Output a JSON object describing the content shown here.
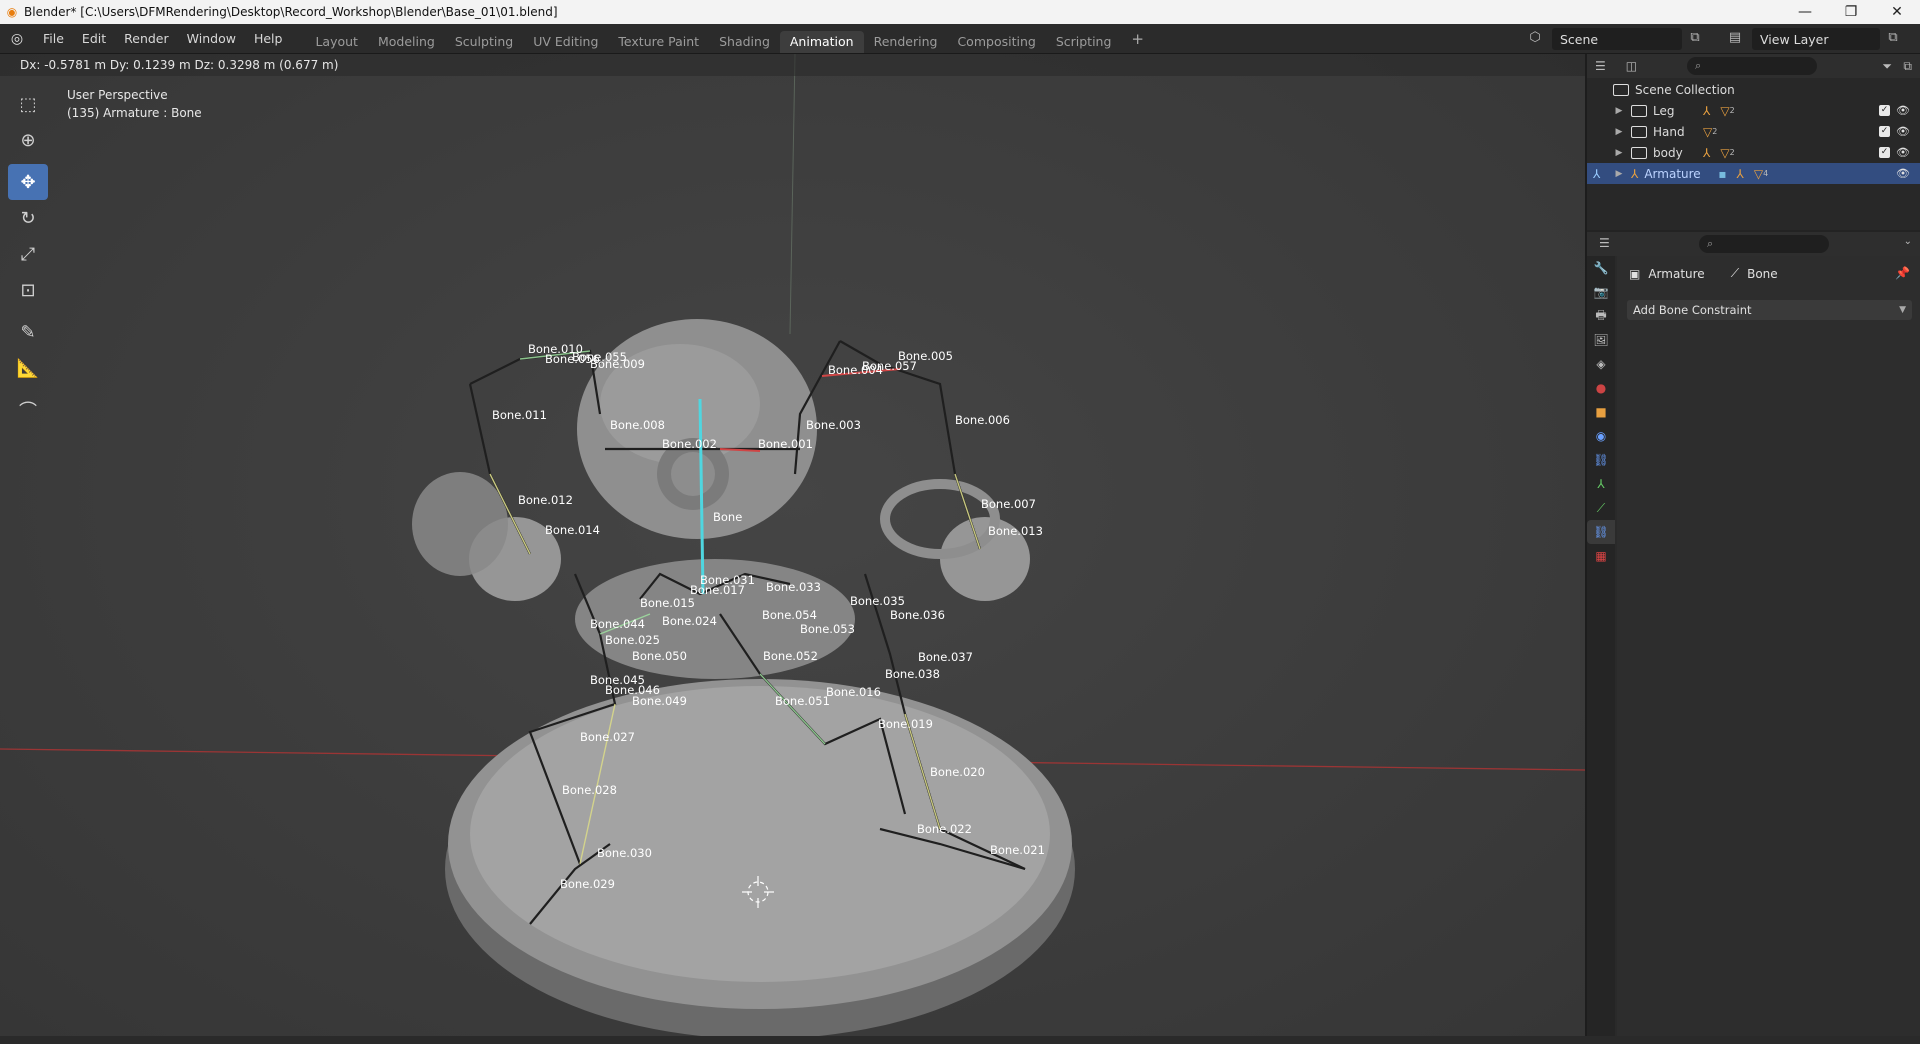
{
  "window": {
    "title": "Blender* [C:\\Users\\DFMRendering\\Desktop\\Record_Workshop\\Blender\\Base_01\\01.blend]",
    "minimize": "—",
    "maximize": "❐",
    "close": "✕"
  },
  "menu": [
    "File",
    "Edit",
    "Render",
    "Window",
    "Help"
  ],
  "workspaces": [
    "Layout",
    "Modeling",
    "Sculpting",
    "UV Editing",
    "Texture Paint",
    "Shading",
    "Animation",
    "Rendering",
    "Compositing",
    "Scripting"
  ],
  "active_workspace": "Animation",
  "add_workspace": "+",
  "scene_name": "Scene",
  "view_layer": "View Layer",
  "viewport": {
    "header_text": "Dx: -0.5781 m  Dy: 0.1239 m  Dz: 0.3298 m (0.677 m)",
    "view_name": "User Perspective",
    "selection_info": "(135) Armature : Bone",
    "bones": [
      {
        "label": "Bone.010"
      },
      {
        "label": "Bone.056"
      },
      {
        "label": "Bone.009"
      },
      {
        "label": "Bone.055"
      },
      {
        "label": "Bone.011"
      },
      {
        "label": "Bone.008"
      },
      {
        "label": "Bone.002"
      },
      {
        "label": "Bone.001"
      },
      {
        "label": "Bone.003"
      },
      {
        "label": "Bone.005"
      },
      {
        "label": "Bone.004"
      },
      {
        "label": "Bone.057"
      },
      {
        "label": "Bone.006"
      },
      {
        "label": "Bone.012"
      },
      {
        "label": "Bone.014"
      },
      {
        "label": "Bone"
      },
      {
        "label": "Bone.007"
      },
      {
        "label": "Bone.013"
      },
      {
        "label": "Bone.031"
      },
      {
        "label": "Bone.033"
      },
      {
        "label": "Bone.035"
      },
      {
        "label": "Bone.036"
      },
      {
        "label": "Bone.054"
      },
      {
        "label": "Bone.053"
      },
      {
        "label": "Bone.024"
      },
      {
        "label": "Bone.044"
      },
      {
        "label": "Bone.025"
      },
      {
        "label": "Bone.050"
      },
      {
        "label": "Bone.052"
      },
      {
        "label": "Bone.037"
      },
      {
        "label": "Bone.038"
      },
      {
        "label": "Bone.045"
      },
      {
        "label": "Bone.046"
      },
      {
        "label": "Bone.049"
      },
      {
        "label": "Bone.016"
      },
      {
        "label": "Bone.051"
      },
      {
        "label": "Bone.019"
      },
      {
        "label": "Bone.027"
      },
      {
        "label": "Bone.020"
      },
      {
        "label": "Bone.028"
      },
      {
        "label": "Bone.022"
      },
      {
        "label": "Bone.021"
      },
      {
        "label": "Bone.030"
      },
      {
        "label": "Bone.029"
      },
      {
        "label": "Bone.017"
      },
      {
        "label": "Bone.015"
      }
    ]
  },
  "outliner": {
    "search_placeholder": "",
    "root": "Scene Collection",
    "items": [
      {
        "name": "Leg",
        "count": "2"
      },
      {
        "name": "Hand",
        "count": "2"
      },
      {
        "name": "body",
        "count": "2"
      },
      {
        "name": "Armature",
        "count": "4"
      }
    ],
    "selected": "Armature"
  },
  "properties": {
    "crumb_object": "Armature",
    "crumb_bone": "Bone",
    "add_constraint": "Add Bone Constraint"
  },
  "colors": {
    "accent": "#4772b3",
    "selected_row": "#334d80",
    "active_bone": "#4fd6e0",
    "grid_x_axis": "#b03a3a"
  }
}
